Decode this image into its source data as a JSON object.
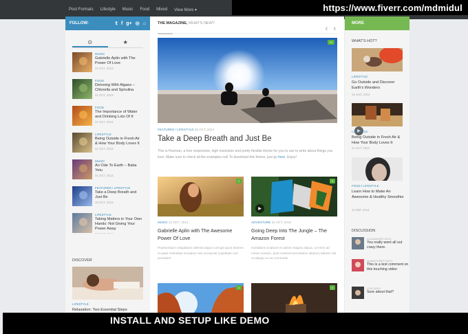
{
  "topnav": [
    "Post Formats",
    "Lifestyle",
    "Music",
    "Food",
    "Mixed",
    "View More ▾"
  ],
  "banner_url": "https://www.fiverr.com/mdmidul",
  "banner_bottom": "INSTALL AND SETUP LIKE DEMO",
  "follow": {
    "label": "FOLLOW:",
    "icons": [
      "𝕥",
      "f",
      "g+",
      "◎",
      "⌂"
    ]
  },
  "left_tabs": [
    "⊙",
    "★"
  ],
  "left_items": [
    {
      "cat": "Music",
      "title": "Gabrielle Aplin with The Power Of Love",
      "date": "21 OCT, 2013",
      "c1": "#7a4a2a",
      "c2": "#e8b06a"
    },
    {
      "cat": "Food",
      "title": "Detoxing With Algaes – Chlorella and Spirulina",
      "date": "21 OCT, 2013",
      "c1": "#2f4f2a",
      "c2": "#8fb56a"
    },
    {
      "cat": "Food",
      "title": "The Importance of Water and Drinking Lots Of It",
      "date": "21 OCT, 2013",
      "c1": "#b34b1a",
      "c2": "#f4b54a"
    },
    {
      "cat": "Lifestyle",
      "title": "Being Outside in Fresh Air & How Your Body Loves It",
      "date": "21 OCT, 2013",
      "c1": "#5a4a30",
      "c2": "#d9c08a"
    },
    {
      "cat": "Music",
      "title": "An Ode To Earth – Baba Yetu",
      "date": "31 OCT, 2013",
      "c1": "#6a3a7a",
      "c2": "#c89a6a"
    },
    {
      "cat": "Featured / Lifestyle",
      "title": "Take a Deep Breath and Just Be",
      "date": "28 OCT, 2013",
      "c1": "#1c3f8a",
      "c2": "#9ab8e8"
    },
    {
      "cat": "Lifestyle",
      "title": "Taking Matters in Your Own Hands: Not Giving Your Power Away",
      "date": "27 OCT, 2013",
      "c1": "#5a7aa0",
      "c2": "#d8c0a8"
    }
  ],
  "discover": {
    "heading": "DISCOVER",
    "cat": "Lifestyle",
    "title": "Relaxation: Two Essential Steps"
  },
  "main": {
    "head_bold": "THE MAGAZINE,",
    "head_rest": " WHAT'S NEW?",
    "arrows": [
      "‹",
      "›"
    ],
    "featured": {
      "badge": "10",
      "cat": "FEATURED / LIFESTYLE",
      "date": "28 OCT, 2013",
      "title": "Take a Deep Breath and Just Be",
      "excerpt_a": "This is Hueman, a free responsive, high resolution and pretty flexible theme for you to use to write about things you love. Make sure to check all the examples out! To download this theme, just go ",
      "excerpt_link": "here",
      "excerpt_b": ". Enjoy!"
    },
    "cards": [
      {
        "badge": "2",
        "cat": "MUSIC",
        "date": "21 OCT, 2013",
        "title": "Gabrielle Aplin with The Awesome Power Of Love",
        "excerpt": "Praesentium voluptatum deleniti atque corrupti quos dolores et quas molestias excepturi sint occaecati cupiditate non provident"
      },
      {
        "badge": "3",
        "cat": "ADVENTURE",
        "date": "31 OCT, 2013",
        "title": "Going Deep Into The Jungle – The Amazon Forest",
        "excerpt": "Incididunt ut labore et dolore magna aliqua. Ut enim ad minim veniam, quis nostrud exercitation ullamco laboris nisi ut aliquip ex ea commodo"
      },
      {
        "badge": "4"
      },
      {
        "badge": "4"
      }
    ]
  },
  "right": {
    "more": "MORE",
    "hot_heading": "WHAT'S HOT?",
    "hot": [
      {
        "cat": "Lifestyle",
        "title": "Go Outside and Discover Earth's Wonders",
        "date": "16 AUG, 2013"
      },
      {
        "cat": "Lifestyle",
        "title": "Being Outside in Fresh Air & How Your Body Loves It",
        "date": "21 OCT, 2013"
      },
      {
        "cat": "Food / Lifestyle",
        "title": "Learn How to Make An Awesome & Healthy Smoothie",
        "date": "13 SEP, 2013"
      }
    ],
    "disc_heading": "DISCUSSION",
    "discussion": [
      {
        "who": "ALEXANDER SAYS",
        "text": "You really went all out crazy there."
      },
      {
        "who": "MANAGORES SAYS",
        "text": "This is a test comment on this touching video"
      },
      {
        "who": "LISA SAYS",
        "text": "Sure about that?"
      }
    ]
  }
}
